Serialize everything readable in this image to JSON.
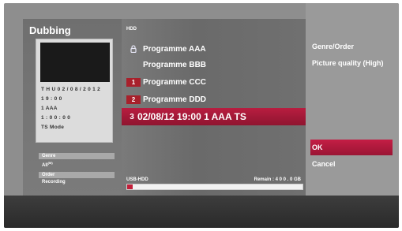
{
  "left": {
    "title": "Dubbing",
    "date": "T H U  0 2 / 0 8 / 2 0 1 2",
    "time": "1 9 : 0 0",
    "channel": "1 AAA",
    "duration": "1 : 0 0 : 0 0",
    "mode": "TS Mode",
    "genre_label": "Genre",
    "genre_value": "All",
    "genre_value_suffix": "(M)",
    "order_label": "Order",
    "order_value": "Recording"
  },
  "main": {
    "device_label": "HDD",
    "items": [
      {
        "number": "",
        "name": "Programme AAA",
        "icon": "lock-icon"
      },
      {
        "number": "",
        "name": "Programme BBB"
      },
      {
        "number": "1",
        "name": "Programme CCC"
      },
      {
        "number": "2",
        "name": "Programme DDD"
      },
      {
        "number": "3",
        "name": "02/08/12 19:00  1 AAA  TS",
        "selected": true
      }
    ],
    "storage_label": "USB-HDD",
    "remain_label": "Remain : 4 0 0 . 0 GB",
    "storage_used_fraction": 0.03
  },
  "menu": {
    "items": [
      {
        "label": "Genre/Order"
      },
      {
        "label": "Picture quality (High)"
      },
      {
        "label": "OK",
        "active": true
      },
      {
        "label": "Cancel"
      }
    ]
  },
  "colors": {
    "accent": "#b81d40",
    "panel": "#707070",
    "background": "#8e8e8e"
  }
}
